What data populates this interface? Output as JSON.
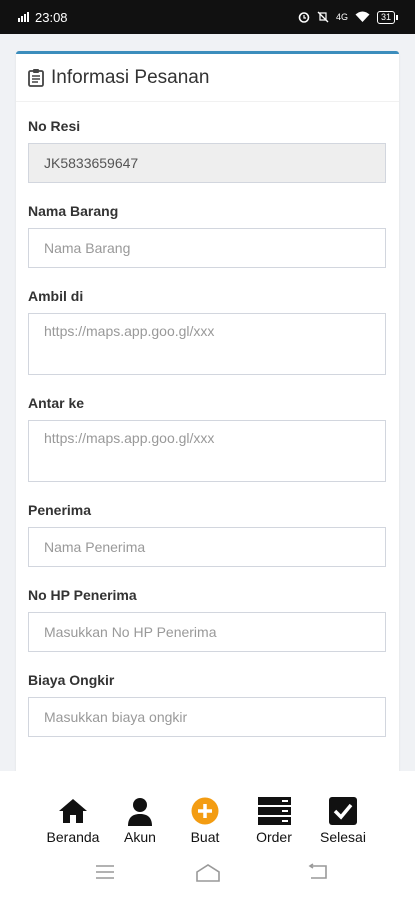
{
  "status_bar": {
    "time": "23:08",
    "network": "4G",
    "battery": "31"
  },
  "card": {
    "title": "Informasi Pesanan"
  },
  "form": {
    "no_resi": {
      "label": "No Resi",
      "value": "JK5833659647"
    },
    "nama_barang": {
      "label": "Nama Barang",
      "placeholder": "Nama Barang"
    },
    "ambil_di": {
      "label": "Ambil di",
      "placeholder": "https://maps.app.goo.gl/xxx"
    },
    "antar_ke": {
      "label": "Antar ke",
      "placeholder": "https://maps.app.goo.gl/xxx"
    },
    "penerima": {
      "label": "Penerima",
      "placeholder": "Nama Penerima"
    },
    "no_hp": {
      "label": "No HP Penerima",
      "placeholder": "Masukkan No HP Penerima"
    },
    "biaya": {
      "label": "Biaya Ongkir",
      "placeholder": "Masukkan biaya ongkir"
    }
  },
  "bottom_nav": {
    "items": [
      {
        "label": "Beranda",
        "icon": "home-icon"
      },
      {
        "label": "Akun",
        "icon": "user-icon"
      },
      {
        "label": "Buat",
        "icon": "plus-circle-icon"
      },
      {
        "label": "Order",
        "icon": "server-icon"
      },
      {
        "label": "Selesai",
        "icon": "check-square-icon"
      }
    ]
  },
  "colors": {
    "accent": "#3c8dbc",
    "danger": "#dd4b39",
    "buat": "#f39c12"
  }
}
